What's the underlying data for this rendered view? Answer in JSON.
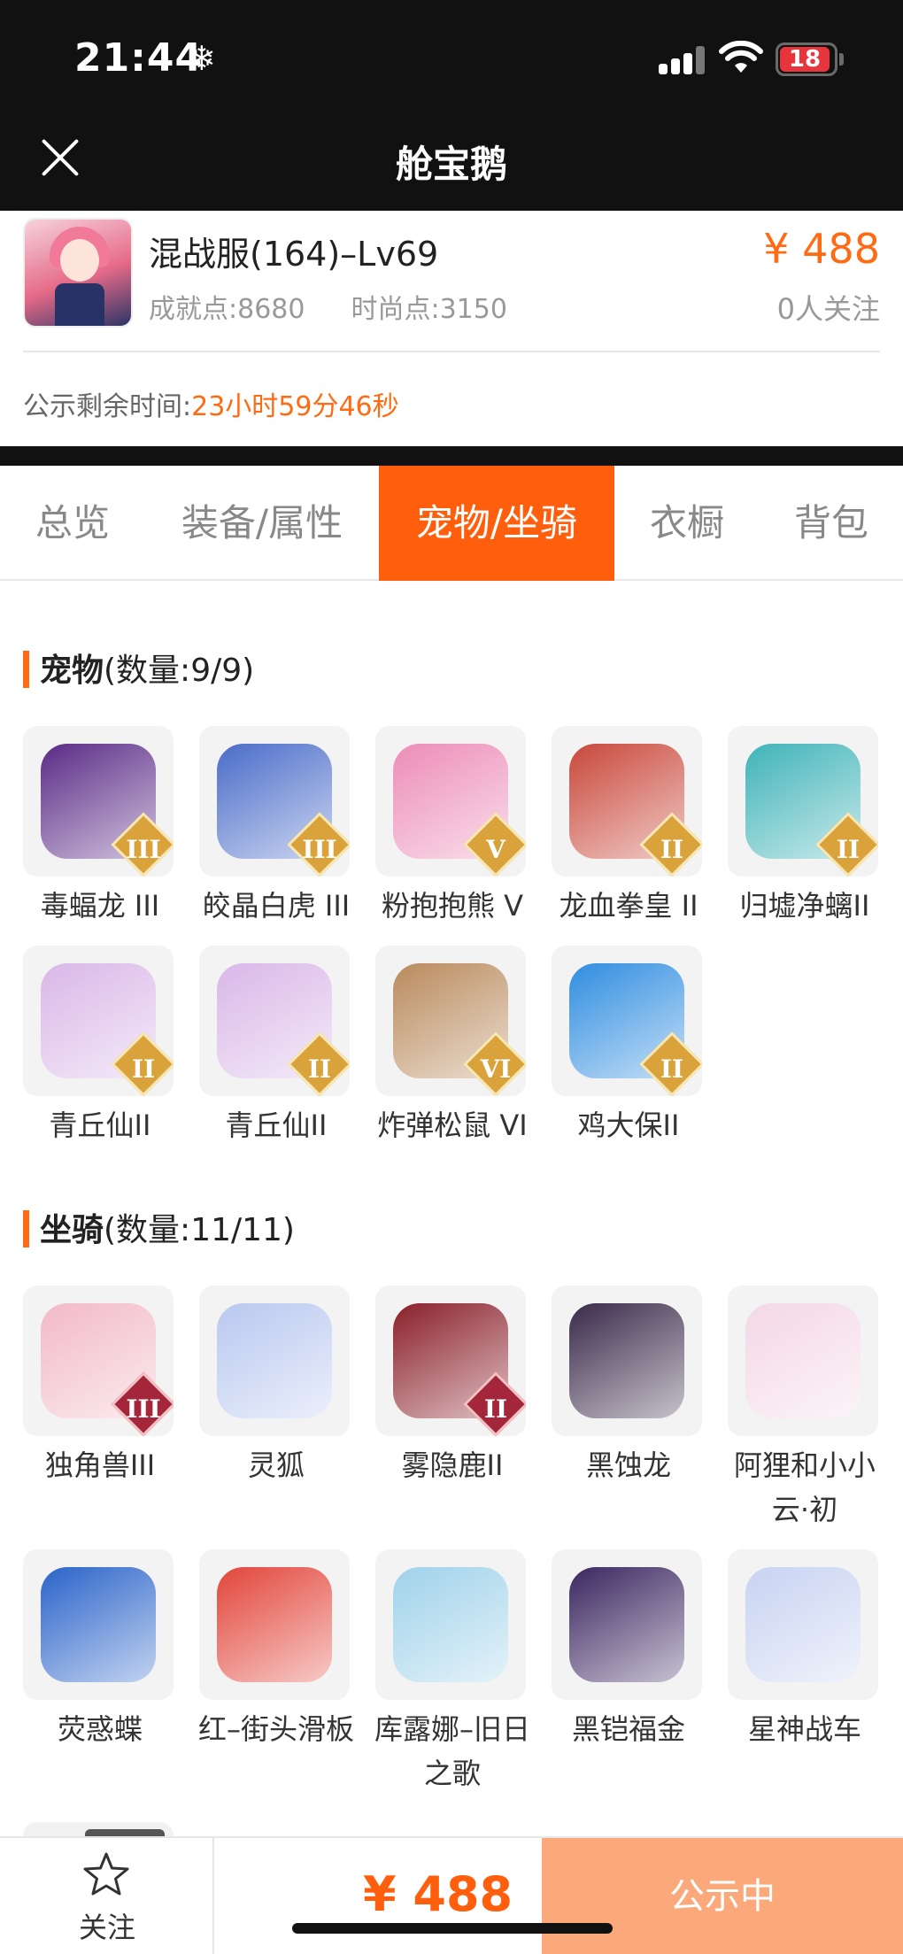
{
  "status_bar": {
    "time": "21:44",
    "battery": "18",
    "snow_glyph": "❄"
  },
  "header": {
    "title": "舱宝鹅"
  },
  "listing": {
    "server": "混战服(164)–Lv69",
    "achievement": "成就点:8680",
    "fashion": "时尚点:3150",
    "price": "¥ 488",
    "followers": "0人关注",
    "remaining_label": "公示剩余时间:",
    "remaining_value": "23小时59分46秒"
  },
  "tabs": [
    {
      "label": "总览",
      "active": false
    },
    {
      "label": "装备/属性",
      "active": false
    },
    {
      "label": "宠物/坐骑",
      "active": true
    },
    {
      "label": "衣橱",
      "active": false
    },
    {
      "label": "背包",
      "active": false
    }
  ],
  "pets": {
    "title": "宠物",
    "count": "(数量:9/9)",
    "items": [
      {
        "name": "毒蝠龙 III",
        "badge": "III",
        "color": "#5a2a86"
      },
      {
        "name": "皎晶白虎 III",
        "badge": "III",
        "color": "#4a6cc9"
      },
      {
        "name": "粉抱抱熊 V",
        "badge": "V",
        "color": "#ec8cb7"
      },
      {
        "name": "龙血拳皇 II",
        "badge": "II",
        "color": "#c9473a"
      },
      {
        "name": "归墟净螭II",
        "badge": "II",
        "color": "#3fb3b8"
      },
      {
        "name": "青丘仙II",
        "badge": "II",
        "color": "#d9b7e8"
      },
      {
        "name": "青丘仙II",
        "badge": "II",
        "color": "#d9b7e8"
      },
      {
        "name": "炸弹松鼠 VI",
        "badge": "VI",
        "color": "#b98a5c"
      },
      {
        "name": "鸡大保II",
        "badge": "II",
        "color": "#2f8de0"
      }
    ]
  },
  "mounts": {
    "title": "坐骑",
    "count": "(数量:11/11)",
    "items": [
      {
        "name": "独角兽III",
        "badge": "III",
        "color": "#f2b9c7"
      },
      {
        "name": "灵狐",
        "badge": "",
        "color": "#b9c8f0"
      },
      {
        "name": "雾隐鹿II",
        "badge": "II",
        "color": "#8a1f2a"
      },
      {
        "name": "黑蚀龙",
        "badge": "",
        "color": "#3a2a4a"
      },
      {
        "name": "阿狸和小小云·初",
        "badge": "",
        "color": "#f4d7e6"
      },
      {
        "name": "荧惑蝶",
        "badge": "",
        "color": "#2a63c9"
      },
      {
        "name": "红–街头滑板",
        "badge": "",
        "color": "#e2453a"
      },
      {
        "name": "库露娜–旧日之歌",
        "badge": "",
        "color": "#9fd2ea"
      },
      {
        "name": "黑铠福金",
        "badge": "",
        "color": "#3b2660"
      },
      {
        "name": "星神战车",
        "badge": "",
        "color": "#c8d3f2"
      }
    ]
  },
  "bottom_bar": {
    "follow_label": "关注",
    "price": "¥ 488",
    "status_button": "公示中"
  }
}
